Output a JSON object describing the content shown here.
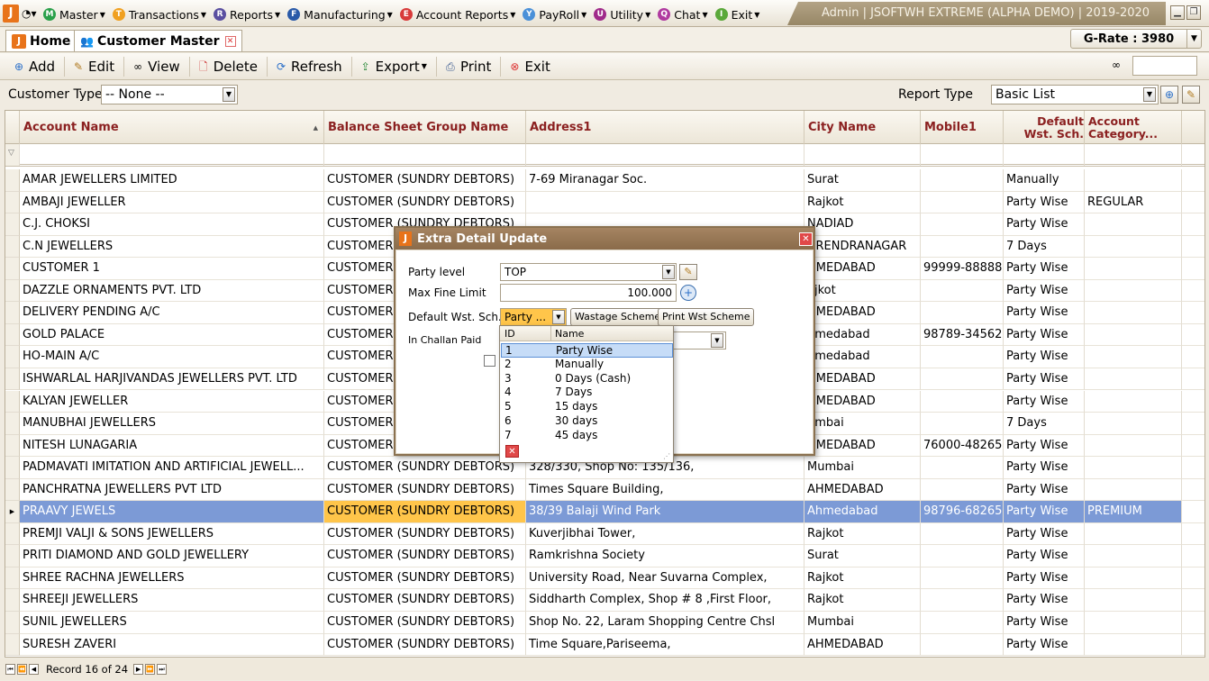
{
  "menubar": {
    "items": [
      {
        "label": "Master",
        "icon": "M",
        "color": "#2aa04a"
      },
      {
        "label": "Transactions",
        "icon": "T",
        "color": "#f0a020"
      },
      {
        "label": "Reports",
        "icon": "R",
        "color": "#5a4fa0"
      },
      {
        "label": "Manufacturing",
        "icon": "F",
        "color": "#2a5aa8"
      },
      {
        "label": "Account Reports",
        "icon": "E",
        "color": "#d83a3a"
      },
      {
        "label": "PayRoll",
        "icon": "Y",
        "color": "#4a90d8"
      },
      {
        "label": "Utility",
        "icon": "U",
        "color": "#a02a8a"
      },
      {
        "label": "Chat",
        "icon": "Q",
        "color": "#b03aa0"
      },
      {
        "label": "Exit",
        "icon": "I",
        "color": "#5aa83a"
      }
    ],
    "title": "Admin | JSOFTWH EXTREME (ALPHA DEMO)  | 2019-2020"
  },
  "tabs": [
    {
      "label": "Home"
    },
    {
      "label": "Customer Master"
    }
  ],
  "grate": "G-Rate : 3980",
  "toolbar": {
    "add": "Add",
    "edit": "Edit",
    "view": "View",
    "delete": "Delete",
    "refresh": "Refresh",
    "export": "Export",
    "print": "Print",
    "exit": "Exit"
  },
  "filters": {
    "customer_type_label": "Customer Type",
    "customer_type_value": "-- None --",
    "report_type_label": "Report Type",
    "report_type_value": "Basic List"
  },
  "grid": {
    "columns": [
      "Account Name",
      "Balance Sheet Group Name",
      "Address1",
      "City Name",
      "Mobile1",
      "Default Wst. Sch.",
      "Account Category..."
    ],
    "rows": [
      [
        "AMAR JEWELLERS LIMITED",
        "CUSTOMER (SUNDRY DEBTORS)",
        "7-69 Miranagar Soc.",
        "Surat",
        "",
        "Manually",
        ""
      ],
      [
        "AMBAJI JEWELLER",
        "CUSTOMER (SUNDRY DEBTORS)",
        "",
        "Rajkot",
        "",
        "Party Wise",
        "REGULAR"
      ],
      [
        "C.J. CHOKSI",
        "CUSTOMER (SUNDRY DEBTORS)",
        "",
        "NADIAD",
        "",
        "Party Wise",
        ""
      ],
      [
        "C.N JEWELLERS",
        "CUSTOMER",
        "",
        "URENDRANAGAR",
        "",
        "7 Days",
        ""
      ],
      [
        "CUSTOMER 1",
        "CUSTOMER",
        "",
        "HMEDABAD",
        "99999-88888",
        "Party Wise",
        ""
      ],
      [
        "DAZZLE ORNAMENTS PVT. LTD",
        "CUSTOMER",
        "",
        "ajkot",
        "",
        "Party Wise",
        ""
      ],
      [
        "DELIVERY PENDING A/C",
        "CUSTOMER",
        "",
        "HMEDABAD",
        "",
        "Party Wise",
        ""
      ],
      [
        "GOLD PALACE",
        "CUSTOMER",
        "",
        "hmedabad",
        "98789-34562",
        "Party Wise",
        ""
      ],
      [
        "HO-MAIN A/C",
        "CUSTOMER",
        "",
        "hmedabad",
        "",
        "Party Wise",
        ""
      ],
      [
        "ISHWARLAL HARJIVANDAS JEWELLERS PVT. LTD",
        "CUSTOMER",
        "",
        "HMEDABAD",
        "",
        "Party Wise",
        ""
      ],
      [
        "KALYAN JEWELLER",
        "CUSTOMER",
        "",
        "HMEDABAD",
        "",
        "Party Wise",
        ""
      ],
      [
        "MANUBHAI JEWELLERS",
        "CUSTOMER",
        "",
        "umbai",
        "",
        "7 Days",
        ""
      ],
      [
        "NITESH LUNAGARIA",
        "CUSTOMER",
        "",
        "HMEDABAD",
        "76000-48265",
        "Party Wise",
        ""
      ],
      [
        "PADMAVATI IMITATION AND ARTIFICIAL JEWELL...",
        "CUSTOMER (SUNDRY DEBTORS)",
        "328/330, Shop No: 135/136,",
        "Mumbai",
        "",
        "Party Wise",
        ""
      ],
      [
        "PANCHRATNA JEWELLERS PVT LTD",
        "CUSTOMER (SUNDRY DEBTORS)",
        "Times Square Building,",
        "AHMEDABAD",
        "",
        "Party Wise",
        ""
      ],
      [
        "PRAAVY JEWELS",
        "CUSTOMER (SUNDRY DEBTORS)",
        "38/39 Balaji Wind Park",
        "Ahmedabad",
        "98796-68265",
        "Party Wise",
        "PREMIUM"
      ],
      [
        "PREMJI VALJI & SONS JEWELLERS",
        "CUSTOMER (SUNDRY DEBTORS)",
        "Kuverjibhai Tower,",
        "Rajkot",
        "",
        "Party Wise",
        ""
      ],
      [
        "PRITI DIAMOND AND GOLD JEWELLERY",
        "CUSTOMER (SUNDRY DEBTORS)",
        "Ramkrishna Society",
        "Surat",
        "",
        "Party Wise",
        ""
      ],
      [
        "SHREE RACHNA JEWELLERS",
        "CUSTOMER (SUNDRY DEBTORS)",
        "University Road, Near Suvarna Complex,",
        "Rajkot",
        "",
        "Party Wise",
        ""
      ],
      [
        "SHREEJI JEWELLERS",
        "CUSTOMER (SUNDRY DEBTORS)",
        "Siddharth Complex, Shop # 8 ,First Floor,",
        "Rajkot",
        "",
        "Party Wise",
        ""
      ],
      [
        "SUNIL JEWELLERS",
        "CUSTOMER (SUNDRY DEBTORS)",
        "Shop No. 22, Laram Shopping Centre Chsl",
        "Mumbai",
        "",
        "Party Wise",
        ""
      ],
      [
        "SURESH ZAVERI",
        "CUSTOMER (SUNDRY DEBTORS)",
        "Time Square,Pariseema,",
        "AHMEDABAD",
        "",
        "Party Wise",
        ""
      ]
    ],
    "selected_row": 15
  },
  "status": {
    "record": "Record 16 of 24"
  },
  "dialog": {
    "title": "Extra Detail Update",
    "party_level_label": "Party level",
    "party_level_value": "TOP",
    "max_fine_label": "Max Fine Limit",
    "max_fine_value": "100.000",
    "default_wst_label": "Default Wst. Sch.",
    "default_wst_value": "Party ...",
    "wastage_scheme_btn": "Wastage Scheme",
    "print_wst_btn": "Print Wst Scheme",
    "in_challan_label": "In Challan Paid"
  },
  "dropdown": {
    "headers": [
      "ID",
      "Name"
    ],
    "rows": [
      [
        "1",
        "Party Wise"
      ],
      [
        "2",
        "Manually"
      ],
      [
        "3",
        "0 Days (Cash)"
      ],
      [
        "4",
        "7 Days"
      ],
      [
        "5",
        "15 days"
      ],
      [
        "6",
        "30 days"
      ],
      [
        "7",
        "45 days"
      ]
    ]
  }
}
